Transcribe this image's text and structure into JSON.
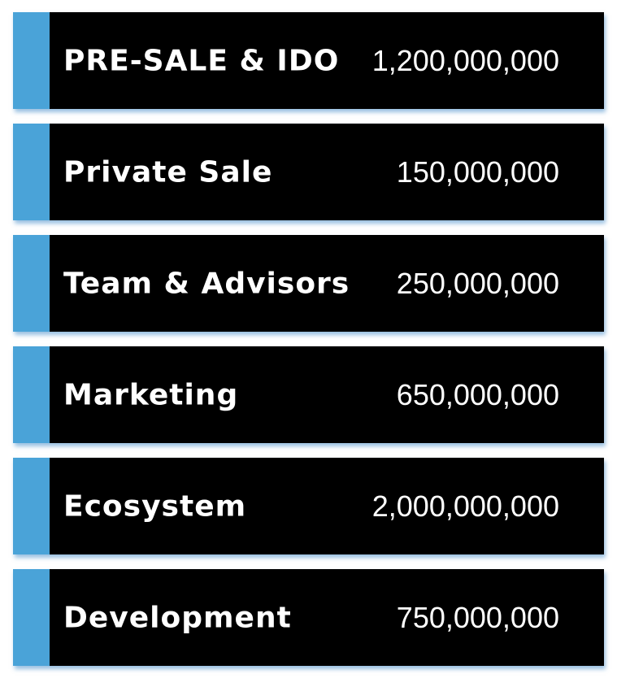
{
  "allocations": [
    {
      "label": "PRE-SALE & IDO",
      "value": "1,200,000,000"
    },
    {
      "label": "Private Sale",
      "value": "150,000,000"
    },
    {
      "label": "Team & Advisors",
      "value": "250,000,000"
    },
    {
      "label": "Marketing",
      "value": "650,000,000"
    },
    {
      "label": "Ecosystem",
      "value": "2,000,000,000"
    },
    {
      "label": "Development",
      "value": "750,000,000"
    }
  ],
  "colors": {
    "accent": "#4aa3d8",
    "panel": "#000000",
    "text": "#ffffff"
  }
}
